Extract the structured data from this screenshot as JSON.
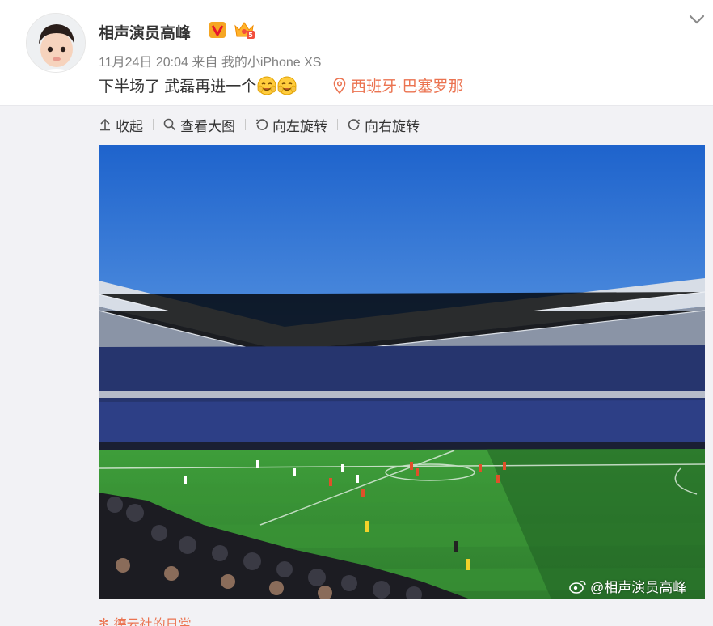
{
  "post": {
    "username": "相声演员高峰",
    "date": "11月24日 20:04",
    "source_prefix": "来自",
    "source": "我的小iPhone XS",
    "text": "下半场了 武磊再进一个",
    "emoji_name": "smiling-face-icon",
    "location": "西班牙·巴塞罗那"
  },
  "toolbar": {
    "collapse": "收起",
    "view_large": "查看大图",
    "rotate_left": "向左旋转",
    "rotate_right": "向右旋转"
  },
  "photo": {
    "watermark": "@相声演员高峰",
    "subject": "football-stadium-photo"
  },
  "footer": {
    "topic": "德云社的日常"
  },
  "colors": {
    "accent": "#eb7350",
    "verified": "#e6162d",
    "text": "#333333",
    "muted": "#808080"
  }
}
